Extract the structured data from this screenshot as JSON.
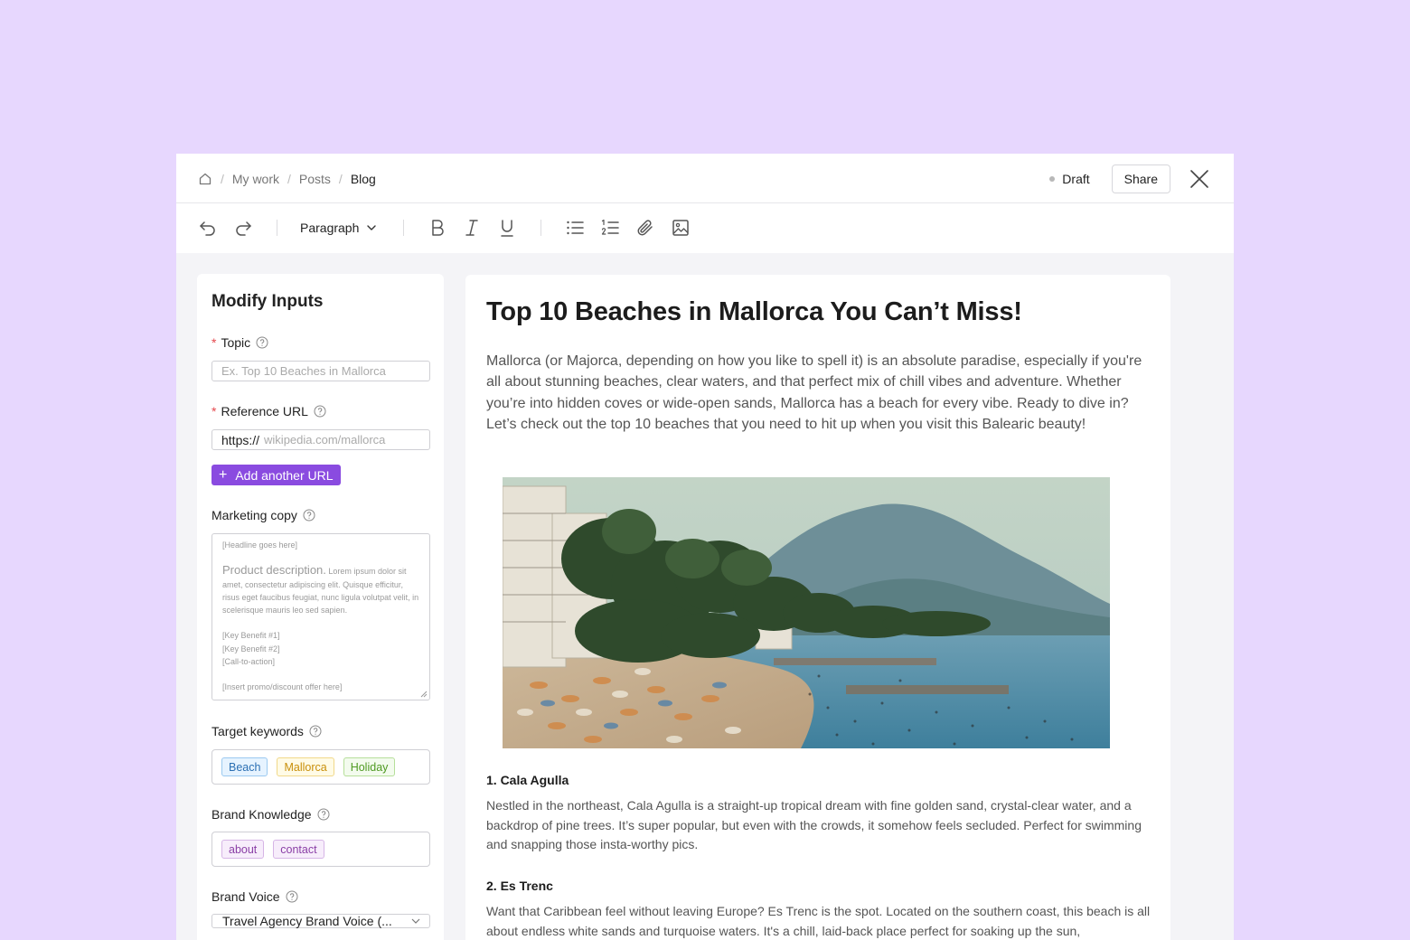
{
  "breadcrumb": {
    "items": [
      "My work",
      "Posts"
    ],
    "current": "Blog"
  },
  "header": {
    "status": "Draft",
    "share_label": "Share"
  },
  "toolbar": {
    "block_style": "Paragraph"
  },
  "panel": {
    "title": "Modify Inputs",
    "topic": {
      "label": "Topic",
      "placeholder": "Ex. Top 10 Beaches in Mallorca"
    },
    "reference_url": {
      "label": "Reference URL",
      "prefix": "https://",
      "placeholder": "wikipedia.com/mallorca",
      "add_label": "Add another URL"
    },
    "marketing_copy": {
      "label": "Marketing copy",
      "headline": "[Headline goes here]",
      "desc_lead": "Product description.",
      "desc_body": "Lorem ipsum dolor sit amet, consectetur adipiscing elit. Quisque efficitur, risus eget faucibus feugiat, nunc ligula volutpat velit, in scelerisque mauris leo sed sapien.",
      "benefit1": "[Key Benefit #1]",
      "benefit2": "[Key Benefit #2]",
      "cta": "[Call-to-action]",
      "promo": "[Insert promo/discount offer here]"
    },
    "target_keywords": {
      "label": "Target keywords",
      "tags": [
        "Beach",
        "Mallorca",
        "Holiday"
      ]
    },
    "brand_knowledge": {
      "label": "Brand Knowledge",
      "tags": [
        "about",
        "contact"
      ]
    },
    "brand_voice": {
      "label": "Brand Voice",
      "value": "Travel Agency Brand Voice (..."
    }
  },
  "doc": {
    "title": "Top 10 Beaches in Mallorca You Can’t Miss!",
    "intro": "Mallorca (or Majorca, depending on how you like to spell it) is an absolute paradise, especially if you're all about stunning beaches, clear waters, and that perfect mix of chill vibes and adventure. Whether you’re into hidden coves or wide-open sands, Mallorca has a beach for every vibe. Ready to dive in? Let’s check out the top 10 beaches that you need to hit up when you visit this Balearic beauty!",
    "sections": [
      {
        "heading": "1. Cala Agulla",
        "body": "Nestled in the northeast, Cala Agulla is a straight-up tropical dream with fine golden sand, crystal-clear water, and a backdrop of pine trees. It’s super popular, but even with the crowds, it somehow feels secluded. Perfect for swimming and snapping those insta-worthy pics."
      },
      {
        "heading": "2. Es Trenc",
        "body": "Want that Caribbean feel without leaving Europe? Es Trenc is the spot. Located on the southern coast, this beach is all about endless white sands and turquoise waters. It's a chill, laid-back place perfect for soaking up the sun,"
      }
    ]
  },
  "colors": {
    "page_bg": "#e7d7fe",
    "accent": "#8a4be0",
    "workspace": "#f4f4f7"
  },
  "icons": [
    "home-icon",
    "undo-icon",
    "redo-icon",
    "chevron-down-icon",
    "bold-icon",
    "italic-icon",
    "underline-icon",
    "bullet-list-icon",
    "numbered-list-icon",
    "attachment-icon",
    "image-icon",
    "help-icon",
    "close-icon",
    "plus-icon"
  ]
}
